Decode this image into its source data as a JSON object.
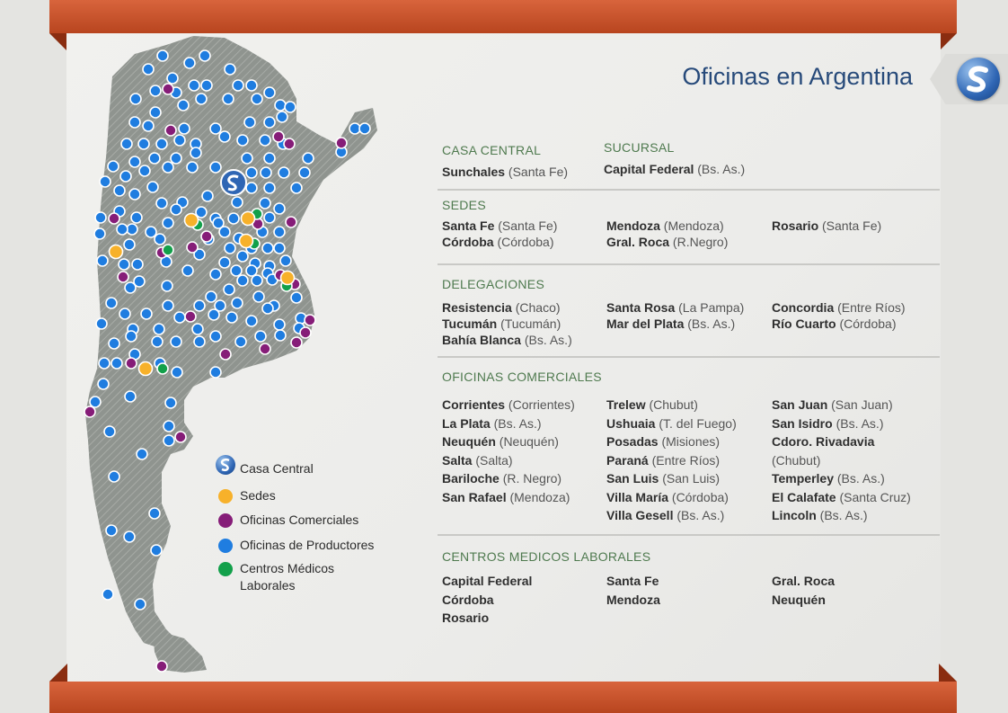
{
  "title": "Oficinas en Argentina",
  "colors": {
    "sedes": "#f7b12a",
    "comerciales": "#861d78",
    "productores": "#1f7de0",
    "medicos": "#12a04a",
    "ribbon": "#c8552c",
    "title": "#274a7a"
  },
  "casa_central": {
    "heading": "CASA CENTRAL",
    "name": "Sunchales",
    "prov": "(Santa Fe)"
  },
  "sucursal": {
    "heading": "SUCURSAL",
    "name": "Capital Federal",
    "prov": "(Bs. As.)"
  },
  "sedes": {
    "heading": "SEDES",
    "cols": [
      [
        {
          "name": "Santa Fe",
          "prov": "(Santa Fe)"
        },
        {
          "name": "Córdoba",
          "prov": "(Córdoba)"
        }
      ],
      [
        {
          "name": "Mendoza",
          "prov": "(Mendoza)"
        },
        {
          "name": "Gral. Roca",
          "prov": "(R.Negro)"
        }
      ],
      [
        {
          "name": "Rosario",
          "prov": "(Santa Fe)"
        }
      ]
    ]
  },
  "delegaciones": {
    "heading": "DELEGACIONES",
    "cols": [
      [
        {
          "name": "Resistencia",
          "prov": "(Chaco)"
        },
        {
          "name": "Tucumán",
          "prov": "(Tucumán)"
        },
        {
          "name": "Bahía Blanca",
          "prov": "(Bs. As.)"
        }
      ],
      [
        {
          "name": "Santa Rosa",
          "prov": "(La Pampa)"
        },
        {
          "name": "Mar del Plata",
          "prov": "(Bs. As.)"
        }
      ],
      [
        {
          "name": "Concordia",
          "prov": "(Entre Ríos)"
        },
        {
          "name": "Río Cuarto",
          "prov": "(Córdoba)"
        }
      ]
    ]
  },
  "comerciales": {
    "heading": "OFICINAS COMERCIALES",
    "cols": [
      [
        {
          "name": "Corrientes",
          "prov": "(Corrientes)"
        },
        {
          "name": "La Plata",
          "prov": "(Bs. As.)"
        },
        {
          "name": "Neuquén",
          "prov": "(Neuquén)"
        },
        {
          "name": "Salta",
          "prov": "(Salta)"
        },
        {
          "name": "Bariloche",
          "prov": "(R. Negro)"
        },
        {
          "name": "San Rafael",
          "prov": "(Mendoza)"
        }
      ],
      [
        {
          "name": "Trelew",
          "prov": "(Chubut)"
        },
        {
          "name": "Ushuaia",
          "prov": "(T. del Fuego)"
        },
        {
          "name": "Posadas",
          "prov": "(Misiones)"
        },
        {
          "name": "Paraná",
          "prov": "(Entre Ríos)"
        },
        {
          "name": "San Luis",
          "prov": "(San Luis)"
        },
        {
          "name": "Villa María",
          "prov": "(Córdoba)"
        },
        {
          "name": "Villa Gesell",
          "prov": "(Bs. As.)"
        }
      ],
      [
        {
          "name": "San Juan",
          "prov": "(San Juan)"
        },
        {
          "name": "San Isidro",
          "prov": "(Bs. As.)"
        },
        {
          "name": "Cdoro. Rivadavia",
          "prov": "(Chubut)"
        },
        {
          "name": "Temperley",
          "prov": "(Bs. As.)"
        },
        {
          "name": "El Calafate",
          "prov": "(Santa Cruz)"
        },
        {
          "name": "Lincoln",
          "prov": "(Bs. As.)"
        }
      ]
    ]
  },
  "medicos": {
    "heading": "CENTROS MEDICOS LABORALES",
    "cols": [
      [
        "Capital Federal",
        "Córdoba",
        "Rosario"
      ],
      [
        "Santa Fe",
        "Mendoza"
      ],
      [
        "Gral. Roca",
        "Neuquén"
      ]
    ]
  },
  "legend": {
    "casa_central": "Casa Central",
    "sedes": "Sedes",
    "comerciales": "Oficinas Comerciales",
    "productores": "Oficinas de Productores",
    "medicos": "Centros Médicos Laborales"
  }
}
